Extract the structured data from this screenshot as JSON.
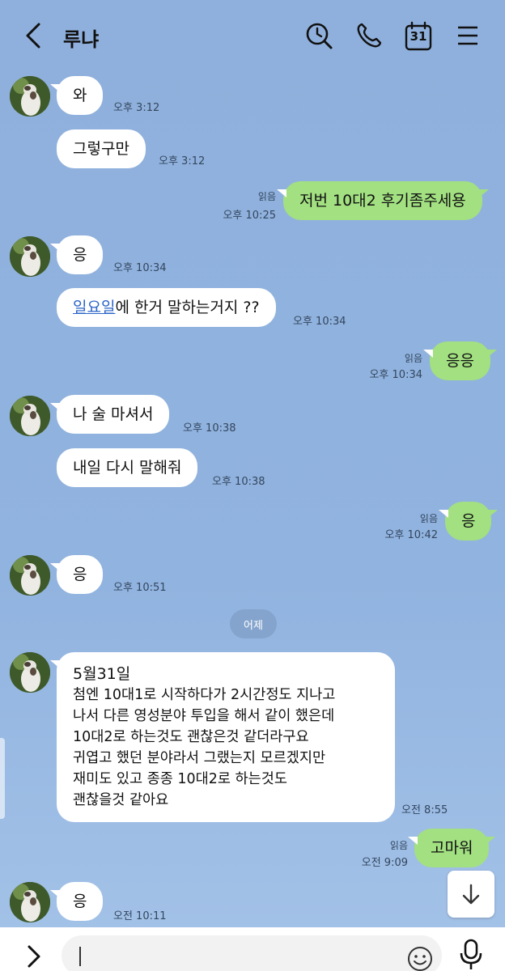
{
  "header": {
    "title": "루냐",
    "back_icon": "chevron-left-icon",
    "search_icon": "search-icon",
    "call_icon": "phone-icon",
    "calendar_icon": "calendar-icon",
    "calendar_day": "31",
    "menu_icon": "hamburger-menu-icon"
  },
  "messages": [
    {
      "text": "와",
      "time": "오후 3:12"
    },
    {
      "text": "그렇구만",
      "time": "오후 3:12"
    },
    {
      "text": "저번 10대2 후기좀주세용",
      "read": "읽음",
      "time": "오후 10:25"
    },
    {
      "text": "응",
      "time": "오후 10:34"
    },
    {
      "link": "일요일",
      "text": "에 한거 말하는거지 ??",
      "time": "오후 10:34"
    },
    {
      "text": "응응",
      "read": "읽음",
      "time": "오후 10:34"
    },
    {
      "text": "나 술 마셔서",
      "time": "오후 10:38"
    },
    {
      "text": "내일 다시 말해줘",
      "time": "오후 10:38"
    },
    {
      "text": "응",
      "read": "읽음",
      "time": "오후 10:42"
    },
    {
      "text": "응",
      "time": "오후 10:51"
    },
    {
      "lines": [
        "5월31일",
        "첨엔 10대1로 시작하다가 2시간정도 지나고",
        "나서 다른 영성분야 투입을 해서 같이 했은데",
        "10대2로 하는것도 괜찮은것 같더라구요",
        "귀엽고 했던 분야라서 그랬는지 모르겠지만",
        "재미도 있고 종종 10대2로 하는것도",
        "괜찮을것 같아요"
      ],
      "time": "오전 8:55"
    },
    {
      "text": "고마워",
      "read": "읽음",
      "time": "오전 9:09"
    },
    {
      "text": "응",
      "time": "오전 10:11"
    }
  ],
  "date_divider": "어제",
  "scroll_down_icon": "arrow-down-icon",
  "input": {
    "plus_icon": "chevron-right-icon",
    "emoji_icon": "emoji-icon",
    "mic_icon": "mic-icon"
  },
  "colors": {
    "background": "#8fb0dc",
    "my_bubble": "#a2e081",
    "their_bubble": "#ffffff",
    "link": "#2b64c8"
  }
}
